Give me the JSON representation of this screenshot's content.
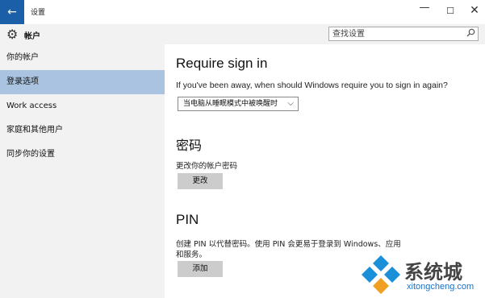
{
  "window": {
    "title": "设置",
    "back_icon": "←",
    "minimize_icon": "—",
    "maximize_icon": "☐",
    "close_icon": "✕"
  },
  "header": {
    "title": "帐户",
    "search_placeholder": "查找设置"
  },
  "sidebar": {
    "items": [
      {
        "label": "你的帐户",
        "selected": false
      },
      {
        "label": "登录选项",
        "selected": true
      },
      {
        "label": "Work access",
        "selected": false
      },
      {
        "label": "家庭和其他用户",
        "selected": false
      },
      {
        "label": "同步你的设置",
        "selected": false
      }
    ]
  },
  "main": {
    "require": {
      "title": "Require sign in",
      "description": "If you've been away, when should Windows require you to sign in again?",
      "dropdown_value": "当电脑从睡眠模式中被唤醒时"
    },
    "password": {
      "title": "密码",
      "description": "更改你的帐户密码",
      "button": "更改"
    },
    "pin": {
      "title": "PIN",
      "description_line1": "创建 PIN 以代替密码。使用 PIN 会更易于登录到 Windows、应用",
      "description_line2": "和服务。",
      "button": "添加"
    }
  },
  "watermark": {
    "text": "系统城",
    "url": "xitongcheng.com"
  },
  "colors": {
    "accent": "#1b5fa8",
    "selected_nav": "#a9c3e0",
    "sidebar_bg": "#f2f2f2",
    "button_bg": "#cccccc"
  }
}
